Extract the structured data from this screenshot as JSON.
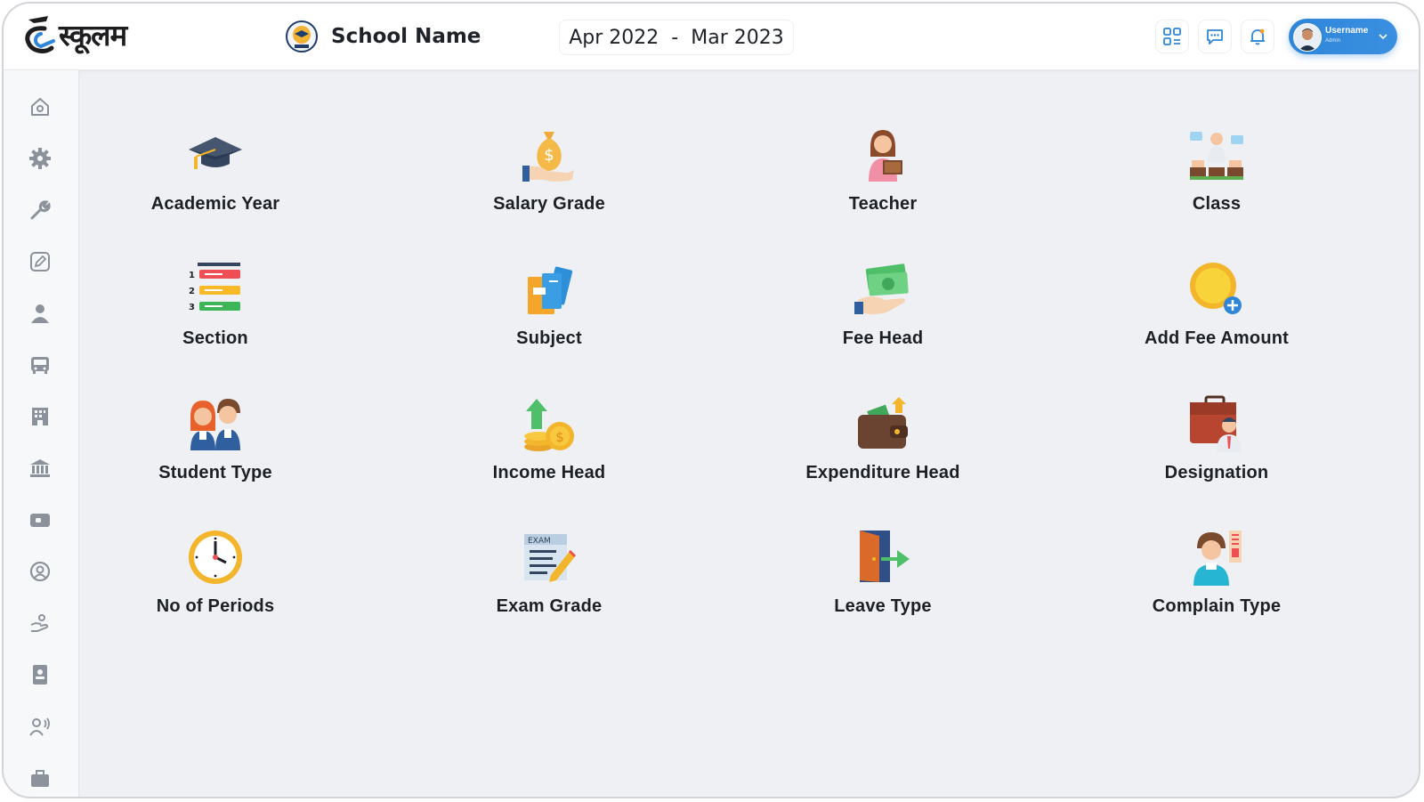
{
  "header": {
    "logo_text": "स्कूलम",
    "school_name": "School Name",
    "session_start": "Apr 2022",
    "session_separator": "-",
    "session_end": "Mar 2023",
    "icons": [
      "grid-icon",
      "chat-icon",
      "bell-icon"
    ],
    "user": {
      "name": "Username",
      "role": "Admin"
    }
  },
  "sidebar": {
    "items": [
      "home-icon",
      "settings-icon",
      "wrench-icon",
      "edit-icon",
      "user-icon",
      "bus-icon",
      "building-icon",
      "bank-icon",
      "wallet-icon",
      "account-icon",
      "donate-icon",
      "contact-book-icon",
      "speaker-icon",
      "briefcase-icon"
    ]
  },
  "tiles": [
    {
      "label": "Academic Year",
      "icon": "graduation-cap-icon"
    },
    {
      "label": "Salary Grade",
      "icon": "money-bag-icon"
    },
    {
      "label": "Teacher",
      "icon": "teacher-icon"
    },
    {
      "label": "Class",
      "icon": "classroom-icon"
    },
    {
      "label": "Section",
      "icon": "numbered-list-icon"
    },
    {
      "label": "Subject",
      "icon": "books-icon"
    },
    {
      "label": "Fee Head",
      "icon": "cash-hand-icon"
    },
    {
      "label": "Add Fee Amount",
      "icon": "coin-plus-icon"
    },
    {
      "label": "Student Type",
      "icon": "students-icon"
    },
    {
      "label": "Income Head",
      "icon": "income-growth-icon"
    },
    {
      "label": "Expenditure Head",
      "icon": "wallet-out-icon"
    },
    {
      "label": "Designation",
      "icon": "businessman-icon"
    },
    {
      "label": "No of Periods",
      "icon": "clock-icon"
    },
    {
      "label": "Exam Grade",
      "icon": "exam-paper-icon"
    },
    {
      "label": "Leave Type",
      "icon": "exit-door-icon"
    },
    {
      "label": "Complain Type",
      "icon": "complaint-icon"
    }
  ],
  "colors": {
    "accent": "#2f86d9",
    "background": "#eef0f4",
    "sidebar_icon": "#8c929b"
  }
}
